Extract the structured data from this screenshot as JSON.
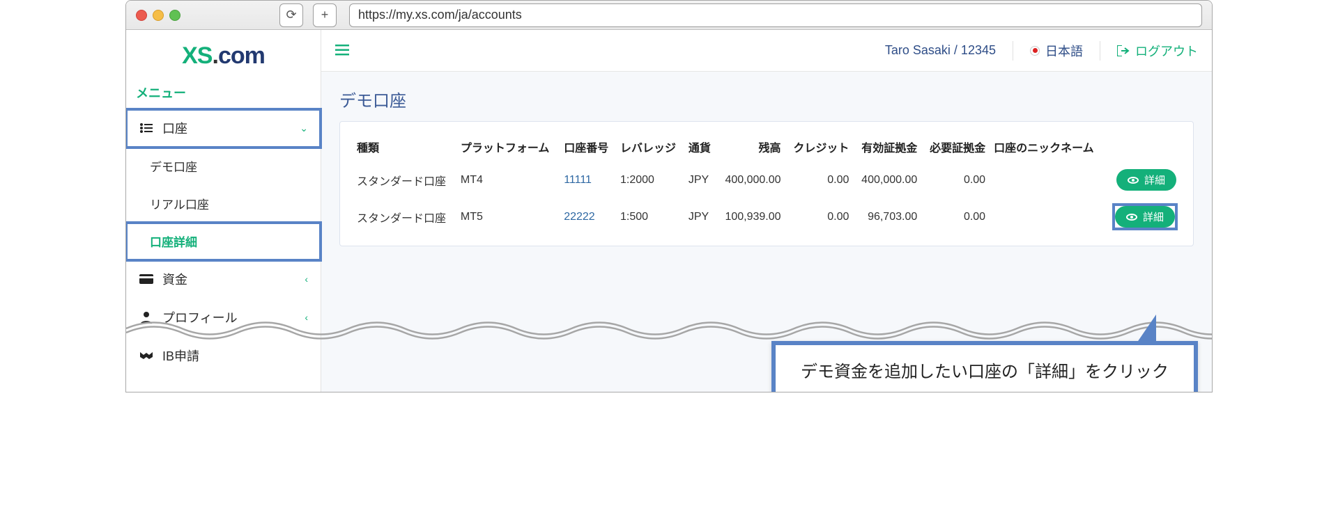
{
  "browser": {
    "url": "https://my.xs.com/ja/accounts"
  },
  "brand": {
    "part1": "XS",
    "part2": ".",
    "part3": "com"
  },
  "sidebar": {
    "menu_label": "メニュー",
    "accounts": "口座",
    "demo": "デモ口座",
    "real": "リアル口座",
    "details": "口座詳細",
    "funds": "資金",
    "profile": "プロフィール",
    "ib": "IB申請"
  },
  "header": {
    "user": "Taro Sasaki / 12345",
    "language": "日本語",
    "logout": "ログアウト"
  },
  "page": {
    "title": "デモ口座"
  },
  "table": {
    "headers": {
      "type": "種類",
      "platform": "プラットフォーム",
      "number": "口座番号",
      "leverage": "レバレッジ",
      "currency": "通貨",
      "balance": "残高",
      "credit": "クレジット",
      "equity": "有効証拠金",
      "margin": "必要証拠金",
      "nickname": "口座のニックネーム"
    },
    "detail_label": "詳細",
    "rows": [
      {
        "type": "スタンダード口座",
        "platform": "MT4",
        "number": "11111",
        "leverage": "1:2000",
        "currency": "JPY",
        "balance": "400,000.00",
        "credit": "0.00",
        "equity": "400,000.00",
        "margin": "0.00",
        "nickname": ""
      },
      {
        "type": "スタンダード口座",
        "platform": "MT5",
        "number": "22222",
        "leverage": "1:500",
        "currency": "JPY",
        "balance": "100,939.00",
        "credit": "0.00",
        "equity": "96,703.00",
        "margin": "0.00",
        "nickname": ""
      }
    ]
  },
  "callout": {
    "text": "デモ資金を追加したい口座の「詳細」をクリック"
  }
}
